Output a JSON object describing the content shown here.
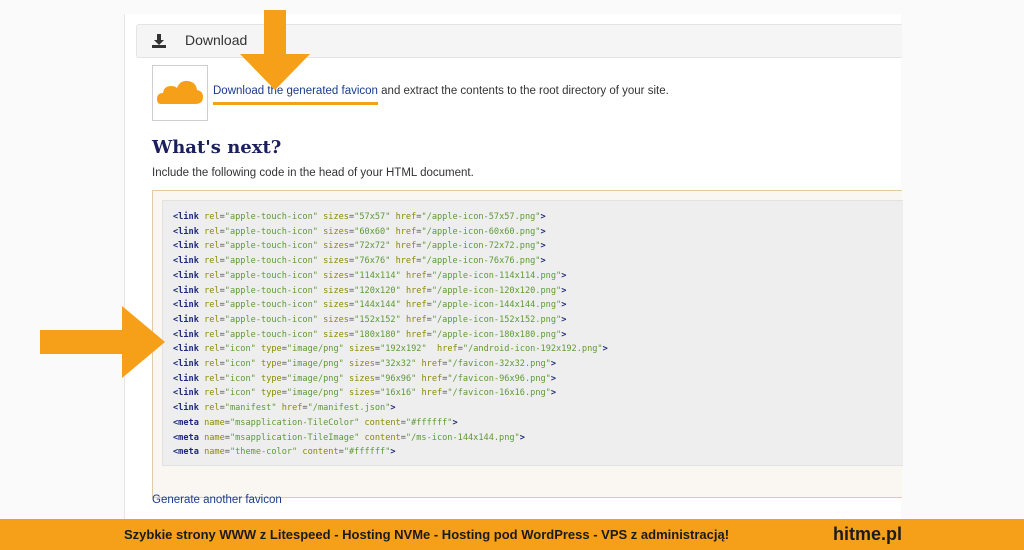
{
  "header": {
    "title": "Download",
    "icon": "download-icon"
  },
  "download_line": {
    "link_text": "Download the generated favicon",
    "rest_text": " and extract the contents to the root directory of your site."
  },
  "next": {
    "title": "What's next?",
    "include_text": "Include the following code in the head of your HTML document."
  },
  "code_lines": [
    {
      "tag": "link",
      "attrs": [
        [
          "rel",
          "apple-touch-icon"
        ],
        [
          "sizes",
          "57x57"
        ],
        [
          "href",
          "/apple-icon-57x57.png"
        ]
      ]
    },
    {
      "tag": "link",
      "attrs": [
        [
          "rel",
          "apple-touch-icon"
        ],
        [
          "sizes",
          "60x60"
        ],
        [
          "href",
          "/apple-icon-60x60.png"
        ]
      ]
    },
    {
      "tag": "link",
      "attrs": [
        [
          "rel",
          "apple-touch-icon"
        ],
        [
          "sizes",
          "72x72"
        ],
        [
          "href",
          "/apple-icon-72x72.png"
        ]
      ]
    },
    {
      "tag": "link",
      "attrs": [
        [
          "rel",
          "apple-touch-icon"
        ],
        [
          "sizes",
          "76x76"
        ],
        [
          "href",
          "/apple-icon-76x76.png"
        ]
      ]
    },
    {
      "tag": "link",
      "attrs": [
        [
          "rel",
          "apple-touch-icon"
        ],
        [
          "sizes",
          "114x114"
        ],
        [
          "href",
          "/apple-icon-114x114.png"
        ]
      ]
    },
    {
      "tag": "link",
      "attrs": [
        [
          "rel",
          "apple-touch-icon"
        ],
        [
          "sizes",
          "120x120"
        ],
        [
          "href",
          "/apple-icon-120x120.png"
        ]
      ]
    },
    {
      "tag": "link",
      "attrs": [
        [
          "rel",
          "apple-touch-icon"
        ],
        [
          "sizes",
          "144x144"
        ],
        [
          "href",
          "/apple-icon-144x144.png"
        ]
      ]
    },
    {
      "tag": "link",
      "attrs": [
        [
          "rel",
          "apple-touch-icon"
        ],
        [
          "sizes",
          "152x152"
        ],
        [
          "href",
          "/apple-icon-152x152.png"
        ]
      ]
    },
    {
      "tag": "link",
      "attrs": [
        [
          "rel",
          "apple-touch-icon"
        ],
        [
          "sizes",
          "180x180"
        ],
        [
          "href",
          "/apple-icon-180x180.png"
        ]
      ]
    },
    {
      "tag": "link",
      "attrs": [
        [
          "rel",
          "icon"
        ],
        [
          "type",
          "image/png"
        ],
        [
          "sizes",
          "192x192"
        ],
        [
          "href",
          "/android-icon-192x192.png"
        ]
      ]
    },
    {
      "tag": "link",
      "attrs": [
        [
          "rel",
          "icon"
        ],
        [
          "type",
          "image/png"
        ],
        [
          "sizes",
          "32x32"
        ],
        [
          "href",
          "/favicon-32x32.png"
        ]
      ]
    },
    {
      "tag": "link",
      "attrs": [
        [
          "rel",
          "icon"
        ],
        [
          "type",
          "image/png"
        ],
        [
          "sizes",
          "96x96"
        ],
        [
          "href",
          "/favicon-96x96.png"
        ]
      ]
    },
    {
      "tag": "link",
      "attrs": [
        [
          "rel",
          "icon"
        ],
        [
          "type",
          "image/png"
        ],
        [
          "sizes",
          "16x16"
        ],
        [
          "href",
          "/favicon-16x16.png"
        ]
      ]
    },
    {
      "tag": "link",
      "attrs": [
        [
          "rel",
          "manifest"
        ],
        [
          "href",
          "/manifest.json"
        ]
      ]
    },
    {
      "tag": "meta",
      "attrs": [
        [
          "name",
          "msapplication-TileColor"
        ],
        [
          "content",
          "#ffffff"
        ]
      ]
    },
    {
      "tag": "meta",
      "attrs": [
        [
          "name",
          "msapplication-TileImage"
        ],
        [
          "content",
          "/ms-icon-144x144.png"
        ]
      ]
    },
    {
      "tag": "meta",
      "attrs": [
        [
          "name",
          "theme-color"
        ],
        [
          "content",
          "#ffffff"
        ]
      ]
    }
  ],
  "generate_link": "Generate another favicon",
  "banner": {
    "promo": "Szybkie strony WWW z Litespeed - Hosting  NVMe - Hosting pod WordPress - VPS z administracją!",
    "brand": "hitme.pl"
  },
  "colors": {
    "accent_orange": "#f6a01a",
    "link_blue": "#1a3a8c",
    "heading_navy": "#1b1f5c"
  }
}
